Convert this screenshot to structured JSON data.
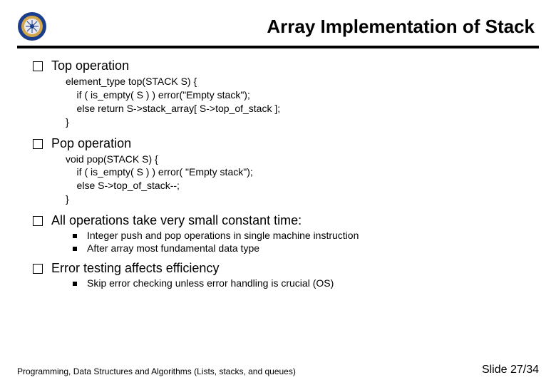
{
  "title": "Array Implementation of Stack",
  "sections": [
    {
      "heading": "Top operation",
      "code": "element_type top(STACK S) {\n    if ( is_empty( S ) ) error(\"Empty stack\");\n    else return S->stack_array[ S->top_of_stack ];\n}",
      "sub": []
    },
    {
      "heading": "Pop operation",
      "code": "void pop(STACK S) {\n    if ( is_empty( S ) ) error( \"Empty stack\");\n    else S->top_of_stack--;\n}",
      "sub": []
    },
    {
      "heading": "All operations take very small constant time:",
      "code": "",
      "sub": [
        "Integer push and pop operations in single machine instruction",
        "After array most fundamental data type"
      ]
    },
    {
      "heading": "Error testing affects efficiency",
      "code": "",
      "sub": [
        "Skip error checking unless error handling is crucial (OS)"
      ]
    }
  ],
  "footer_left": "Programming, Data Structures and Algorithms  (Lists, stacks, and queues)",
  "footer_right": "Slide 27/34"
}
